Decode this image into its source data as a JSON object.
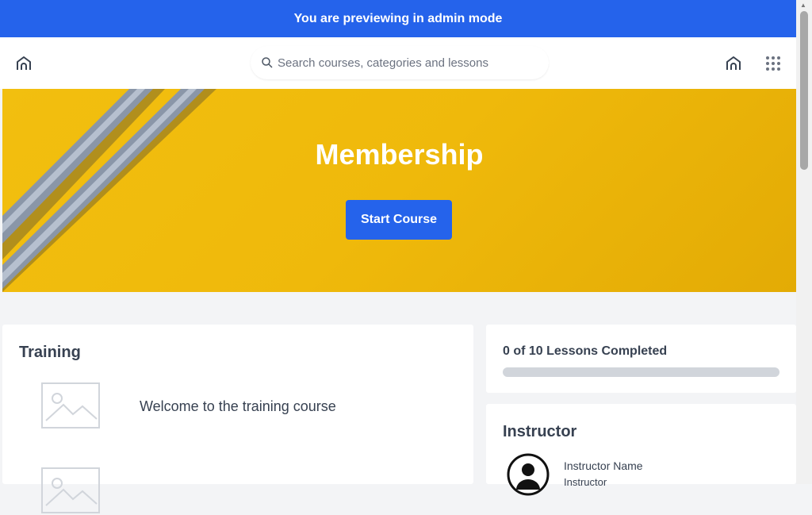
{
  "banner": {
    "text": "You are previewing in admin mode"
  },
  "nav": {
    "search_placeholder": "Search courses, categories and lessons",
    "icons": [
      "home-icon",
      "search-icon",
      "home-icon",
      "apps-grid-icon"
    ]
  },
  "hero": {
    "title": "Membership",
    "start_button": "Start Course"
  },
  "training": {
    "title": "Training",
    "lessons": [
      {
        "label": "Welcome to the training course",
        "thumb": "image-placeholder-icon"
      },
      {
        "label": "",
        "thumb": "image-placeholder-icon"
      }
    ]
  },
  "progress": {
    "label": "0 of 10 Lessons Completed",
    "completed": 0,
    "total": 10
  },
  "instructor": {
    "title": "Instructor",
    "name": "Instructor Name",
    "role": "Instructor"
  },
  "colors": {
    "accent": "#2563eb",
    "hero_bg": "#efb90b",
    "text": "#374151",
    "page_bg": "#f3f4f6"
  }
}
